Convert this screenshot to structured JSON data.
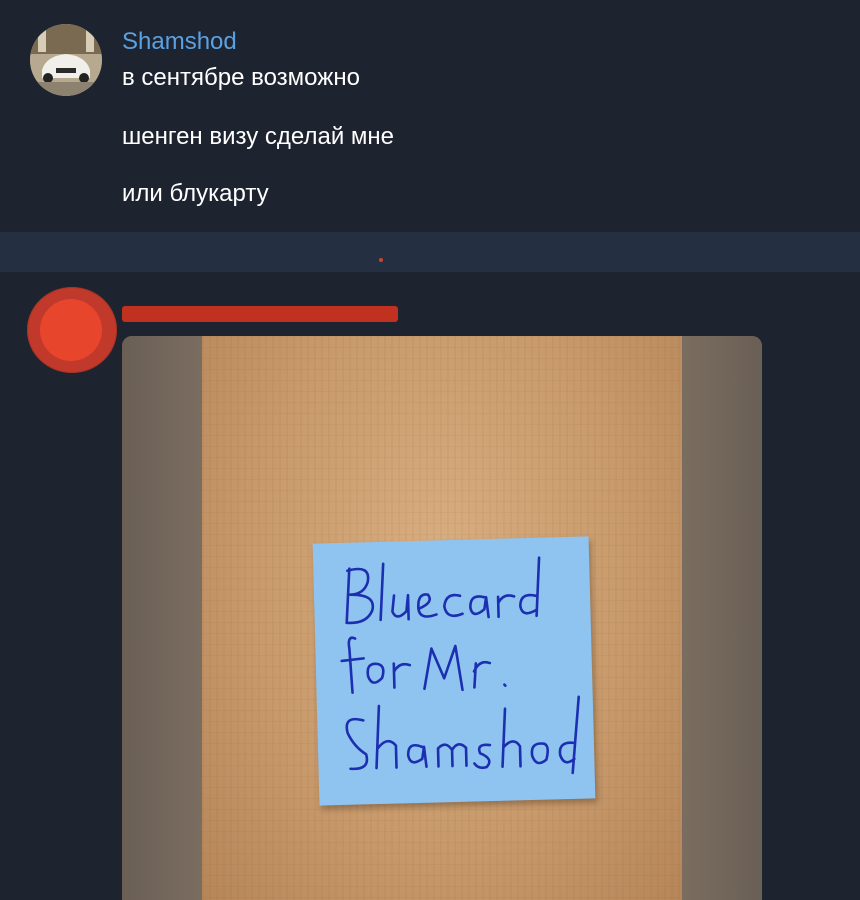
{
  "messages": [
    {
      "sender": "Shamshod",
      "avatar": "car-photo-avatar",
      "texts": [
        "в сентябре возможно",
        "шенген визу сделай мне",
        "или блукарту"
      ]
    },
    {
      "sender_redacted": true,
      "avatar": "redacted-red-avatar",
      "attachment": {
        "type": "photo",
        "description_icon": "sticky-note-photo",
        "note_text": [
          "Bluecard",
          "for Mr.",
          "Shamshod"
        ]
      }
    }
  ],
  "colors": {
    "background": "#1d2430",
    "separator": "#243042",
    "sender_name": "#5aa1e3",
    "message_text": "#ffffff",
    "redaction": "#c0311f",
    "sticky_note": "#8fc3f0",
    "ink": "#1c2fb0"
  }
}
